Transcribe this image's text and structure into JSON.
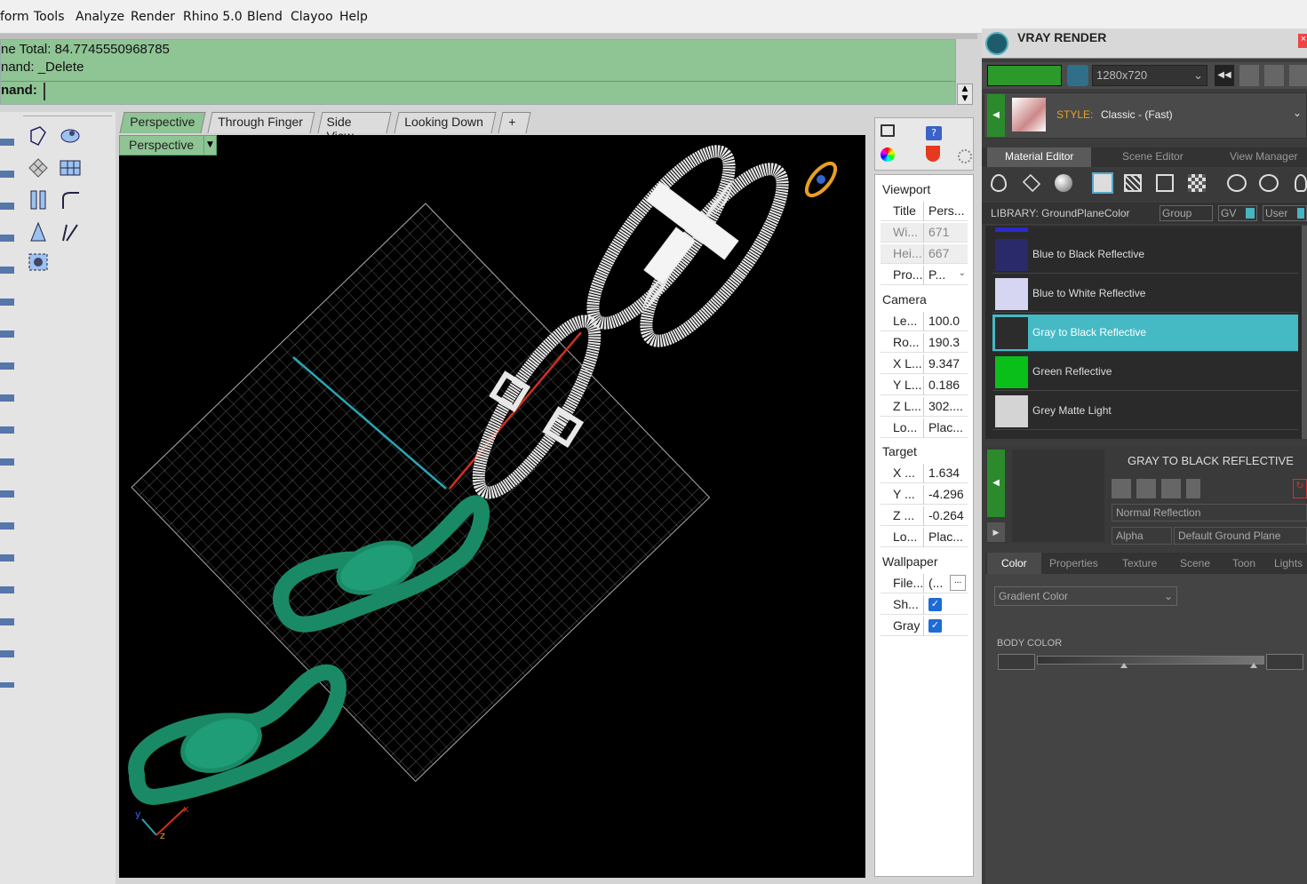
{
  "menu": [
    "form",
    "Tools",
    "Analyze",
    "Render",
    "Rhino 5.0",
    "Blend",
    "Clayoo",
    "Help"
  ],
  "command": {
    "line1": "ne Total: 84.7745550968785",
    "line2": "nand: _Delete",
    "prompt": "nand:"
  },
  "viewport_tabs": [
    "Perspective",
    "Through Finger",
    "Side View",
    "Looking Down",
    "+"
  ],
  "viewport_label": "Perspective",
  "properties": {
    "viewport_header": "Viewport",
    "viewport_rows": [
      {
        "k": "Title",
        "v": "Pers..."
      },
      {
        "k": "Wi...",
        "v": "671"
      },
      {
        "k": "Hei...",
        "v": "667"
      },
      {
        "k": "Pro...",
        "v": "P..."
      }
    ],
    "camera_header": "Camera",
    "camera_rows": [
      {
        "k": "Le...",
        "v": "100.0"
      },
      {
        "k": "Ro...",
        "v": "190.3"
      },
      {
        "k": "X L...",
        "v": "9.347"
      },
      {
        "k": "Y L...",
        "v": "0.186"
      },
      {
        "k": "Z L...",
        "v": "302...."
      },
      {
        "k": "Lo...",
        "v": "Plac..."
      }
    ],
    "target_header": "Target",
    "target_rows": [
      {
        "k": "X ...",
        "v": "1.634"
      },
      {
        "k": "Y ...",
        "v": "-4.296"
      },
      {
        "k": "Z ...",
        "v": "-0.264"
      },
      {
        "k": "Lo...",
        "v": "Plac..."
      }
    ],
    "wallpaper_header": "Wallpaper",
    "wallpaper_rows": [
      {
        "k": "File...",
        "v": "(..."
      },
      {
        "k": "Sh...",
        "v": ""
      },
      {
        "k": "Gray",
        "v": ""
      }
    ]
  },
  "vray": {
    "title": "VRAY RENDER",
    "resolution": "1280x720",
    "style_label": "STYLE:",
    "style_value": "Classic - (Fast)",
    "tabs": [
      "Material Editor",
      "Scene Editor",
      "View Manager"
    ],
    "library": "LIBRARY: GroundPlaneColor",
    "lib_buttons": [
      "Group",
      "GV",
      "User"
    ],
    "materials": [
      {
        "name": "Blue to Black Reflective",
        "color": "#2a2a6a"
      },
      {
        "name": "Blue to White Reflective",
        "color": "#d6d6f2"
      },
      {
        "name": "Gray to Black Reflective",
        "color": "#2c2c2c"
      },
      {
        "name": "Green Reflective",
        "color": "#0bbf1a"
      },
      {
        "name": "Grey Matte Light",
        "color": "#d4d4d4"
      }
    ],
    "selected_title": "GRAY TO BLACK REFLECTIVE",
    "reflection": "Normal Reflection",
    "alpha": "Alpha",
    "ground_plane": "Default Ground Plane",
    "lower_tabs": [
      "Color",
      "Properties",
      "Texture",
      "Scene",
      "Toon",
      "Lights"
    ],
    "gradient": "Gradient Color",
    "body_color": "BODY COLOR"
  }
}
